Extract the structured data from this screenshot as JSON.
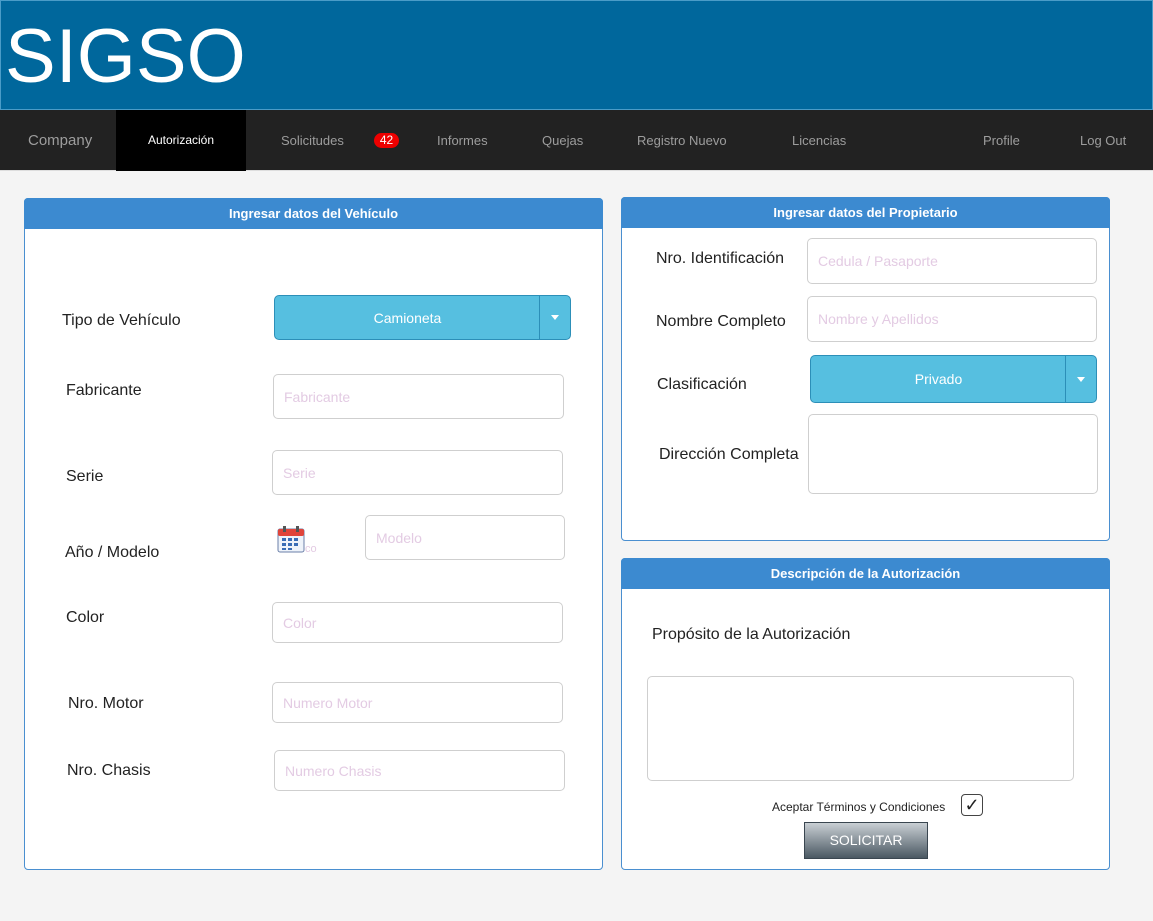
{
  "app": {
    "logo": "SIGSO"
  },
  "nav": {
    "brand": "Company",
    "autorizacion": "Autorización",
    "solicitudes": "Solicitudes",
    "solicitudes_badge": "42",
    "informes": "Informes",
    "quejas": "Quejas",
    "registro_nuevo": "Registro Nuevo",
    "licencias": "Licencias",
    "profile": "Profile",
    "logout": "Log Out"
  },
  "vehicle": {
    "title": "Ingresar datos del Vehículo",
    "tipo_label": "Tipo de Vehículo",
    "tipo_value": "Camioneta",
    "fabricante_label": "Fabricante",
    "fabricante_placeholder": "Fabricante",
    "serie_label": "Serie",
    "serie_placeholder": "Serie",
    "anio_label": "Año / Modelo",
    "modelo_placeholder": "Modelo",
    "color_label": "Color",
    "color_placeholder": "Color",
    "motor_label": "Nro. Motor",
    "motor_placeholder": "Numero Motor",
    "chasis_label": "Nro. Chasis",
    "chasis_placeholder": "Numero Chasis"
  },
  "owner": {
    "title": "Ingresar datos del Propietario",
    "id_label": "Nro. Identificación",
    "id_placeholder": "Cedula / Pasaporte",
    "nombre_label": "Nombre Completo",
    "nombre_placeholder": "Nombre y Apellidos",
    "clasificacion_label": "Clasificación",
    "clasificacion_value": "Privado",
    "direccion_label": "Dirección Completa"
  },
  "authorization": {
    "title": "Descripción de la Autorización",
    "proposito_label": "Propósito de la Autorización",
    "terms_label": "Aceptar Términos y Condiciones",
    "terms_checked": "✓",
    "submit_label": "SOLICITAR"
  },
  "colors": {
    "header": "#00679c",
    "nav": "#222222",
    "panel_header": "#3c8ad0",
    "select": "#56bfe0",
    "badge": "#ee0000"
  }
}
